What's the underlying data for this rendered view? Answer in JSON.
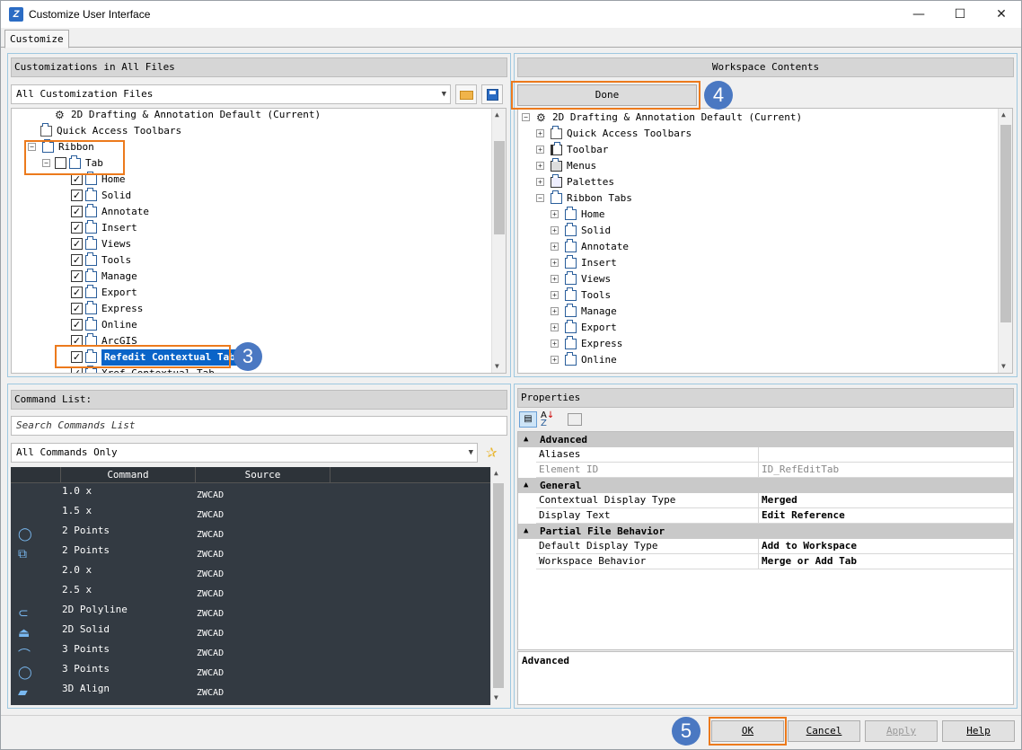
{
  "window": {
    "title": "Customize User Interface",
    "minimize": "—",
    "maximize": "☐",
    "close": "✕"
  },
  "tabs": [
    "Customize"
  ],
  "left_top": {
    "header": "Customizations in All Files",
    "combo": "All Customization Files",
    "tree": [
      {
        "label": "2D Drafting & Annotation Default (Current)",
        "indent": 0,
        "icon": "gear"
      },
      {
        "label": "Quick Access Toolbars",
        "indent": 0,
        "icon": "qat"
      },
      {
        "label": "Ribbon",
        "indent": 0,
        "icon": "tab",
        "expander": "−"
      },
      {
        "label": "Tab",
        "indent": 1,
        "icon": "tab",
        "expander": "−",
        "checkbox": ""
      },
      {
        "label": "Home",
        "indent": 2,
        "icon": "tab",
        "checkbox": "✓"
      },
      {
        "label": "Solid",
        "indent": 2,
        "icon": "tab",
        "checkbox": "✓"
      },
      {
        "label": "Annotate",
        "indent": 2,
        "icon": "tab",
        "checkbox": "✓"
      },
      {
        "label": "Insert",
        "indent": 2,
        "icon": "tab",
        "checkbox": "✓"
      },
      {
        "label": "Views",
        "indent": 2,
        "icon": "tab",
        "checkbox": "✓"
      },
      {
        "label": "Tools",
        "indent": 2,
        "icon": "tab",
        "checkbox": "✓"
      },
      {
        "label": "Manage",
        "indent": 2,
        "icon": "tab",
        "checkbox": "✓"
      },
      {
        "label": "Export",
        "indent": 2,
        "icon": "tab",
        "checkbox": "✓"
      },
      {
        "label": "Express",
        "indent": 2,
        "icon": "tab",
        "checkbox": "✓"
      },
      {
        "label": "Online",
        "indent": 2,
        "icon": "tab",
        "checkbox": "✓"
      },
      {
        "label": "ArcGIS",
        "indent": 2,
        "icon": "tab",
        "checkbox": "✓"
      },
      {
        "label": "Refedit Contextual Tab",
        "indent": 2,
        "icon": "tab",
        "checkbox": "✓",
        "selected": true
      },
      {
        "label": "Xref Contextual Tab",
        "indent": 2,
        "icon": "tab",
        "checkbox": "✓"
      }
    ]
  },
  "workspace": {
    "header": "Workspace Contents",
    "done_label": "Done",
    "tree": [
      {
        "label": "2D Drafting & Annotation Default (Current)",
        "level": 0,
        "icon": "gear",
        "expander": "−"
      },
      {
        "label": "Quick Access Toolbars",
        "level": 1,
        "icon": "qat",
        "expander": "+"
      },
      {
        "label": "Toolbar",
        "level": 1,
        "icon": "toolbar",
        "expander": "+"
      },
      {
        "label": "Menus",
        "level": 1,
        "icon": "menu",
        "expander": "+"
      },
      {
        "label": "Palettes",
        "level": 1,
        "icon": "palette",
        "expander": "+"
      },
      {
        "label": "Ribbon Tabs",
        "level": 1,
        "icon": "tab",
        "expander": "−"
      },
      {
        "label": "Home",
        "level": 2,
        "icon": "tab",
        "expander": "+"
      },
      {
        "label": "Solid",
        "level": 2,
        "icon": "tab",
        "expander": "+"
      },
      {
        "label": "Annotate",
        "level": 2,
        "icon": "tab",
        "expander": "+"
      },
      {
        "label": "Insert",
        "level": 2,
        "icon": "tab",
        "expander": "+"
      },
      {
        "label": "Views",
        "level": 2,
        "icon": "tab",
        "expander": "+"
      },
      {
        "label": "Tools",
        "level": 2,
        "icon": "tab",
        "expander": "+"
      },
      {
        "label": "Manage",
        "level": 2,
        "icon": "tab",
        "expander": "+"
      },
      {
        "label": "Export",
        "level": 2,
        "icon": "tab",
        "expander": "+"
      },
      {
        "label": "Express",
        "level": 2,
        "icon": "tab",
        "expander": "+"
      },
      {
        "label": "Online",
        "level": 2,
        "icon": "tab",
        "expander": "+"
      }
    ]
  },
  "commands": {
    "header": "Command List:",
    "search_placeholder": "Search Commands List",
    "filter": "All Commands Only",
    "columns": [
      "Command",
      "Source"
    ],
    "rows": [
      {
        "icon": "",
        "name": "1.0 x",
        "source": "ZWCAD"
      },
      {
        "icon": "",
        "name": "1.5 x",
        "source": "ZWCAD"
      },
      {
        "icon": "◯",
        "name": "2 Points",
        "source": "ZWCAD"
      },
      {
        "icon": "⧉",
        "name": "2 Points",
        "source": "ZWCAD"
      },
      {
        "icon": "",
        "name": "2.0 x",
        "source": "ZWCAD"
      },
      {
        "icon": "",
        "name": "2.5 x",
        "source": "ZWCAD"
      },
      {
        "icon": "⊂",
        "name": "2D Polyline",
        "source": "ZWCAD"
      },
      {
        "icon": "⏏",
        "name": "2D Solid",
        "source": "ZWCAD"
      },
      {
        "icon": "⌒",
        "name": "3 Points",
        "source": "ZWCAD"
      },
      {
        "icon": "◯",
        "name": "3 Points",
        "source": "ZWCAD"
      },
      {
        "icon": "▰",
        "name": "3D Align",
        "source": "ZWCAD"
      }
    ]
  },
  "properties": {
    "header": "Properties",
    "groups": [
      {
        "name": "Advanced",
        "rows": [
          {
            "k": "Aliases",
            "v": "",
            "grey": false
          },
          {
            "k": "Element ID",
            "v": "ID_RefEditTab",
            "grey": true
          }
        ]
      },
      {
        "name": "General",
        "rows": [
          {
            "k": "Contextual Display Type",
            "v": "Merged",
            "grey": false
          },
          {
            "k": "Display Text",
            "v": "Edit Reference",
            "grey": false
          }
        ]
      },
      {
        "name": "Partial File Behavior",
        "rows": [
          {
            "k": "Default Display Type",
            "v": "Add to Workspace",
            "grey": false
          },
          {
            "k": "Workspace Behavior",
            "v": "Merge or Add Tab",
            "grey": false
          }
        ]
      }
    ],
    "description_title": "Advanced"
  },
  "buttons": {
    "ok": "OK",
    "cancel": "Cancel",
    "apply": "Apply",
    "help": "Help"
  },
  "badges": {
    "b3": "3",
    "b4": "4",
    "b5": "5"
  },
  "colors": {
    "highlight": "#ec7a1c",
    "badge": "#4a78c2",
    "selection": "#0a64c8"
  }
}
